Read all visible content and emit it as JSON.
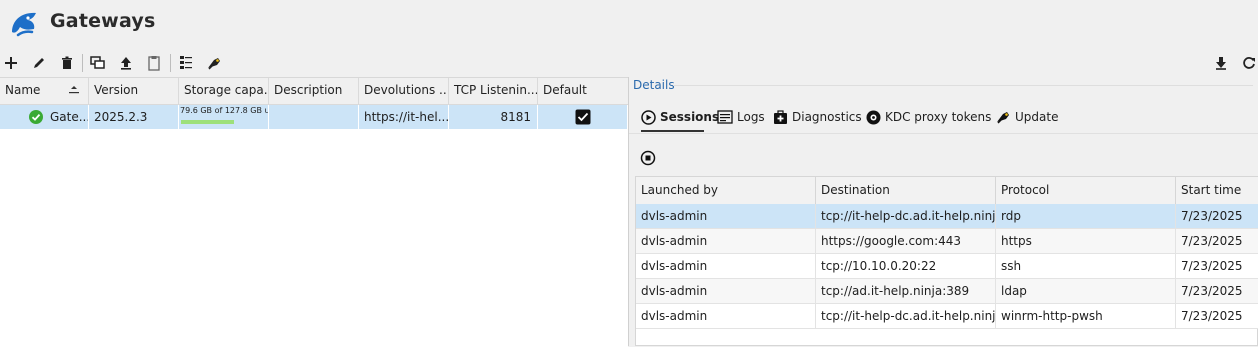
{
  "app": {
    "title": "Gateways"
  },
  "toolbar": {
    "left": [
      "add-icon",
      "edit-icon",
      "delete-icon",
      "duplicate-icon",
      "upload-icon",
      "clipboard-icon",
      "properties-icon",
      "key-icon"
    ],
    "right": [
      "download-icon",
      "refresh-icon"
    ]
  },
  "gateways": {
    "columns": [
      "Name",
      "Version",
      "Storage capa...",
      "Description",
      "Devolutions ...",
      "TCP Listenin...",
      "Default"
    ],
    "rows": [
      {
        "name": "Gate...",
        "version": "2025.2.3",
        "storage": "79.6 GB of 127.8 GB us",
        "storage_fraction": 0.62,
        "description": "",
        "url": "https://it-hel...",
        "tcp_port": "8181",
        "default": true,
        "status": "online"
      }
    ]
  },
  "details": {
    "label": "Details",
    "tabs": [
      {
        "label": "Sessions",
        "icon": "play-icon",
        "active": true
      },
      {
        "label": "Logs",
        "icon": "logs-icon"
      },
      {
        "label": "Diagnostics",
        "icon": "diagnostics-icon"
      },
      {
        "label": "KDC proxy tokens",
        "icon": "token-icon"
      },
      {
        "label": "Update",
        "icon": "update-icon"
      }
    ],
    "sessions": {
      "columns": [
        "Launched by",
        "Destination",
        "Protocol",
        "Start time"
      ],
      "rows": [
        {
          "launched_by": "dvls-admin",
          "destination": "tcp://it-help-dc.ad.it-help.ninj...",
          "protocol": "rdp",
          "start": "7/23/2025"
        },
        {
          "launched_by": "dvls-admin",
          "destination": "https://google.com:443",
          "protocol": "https",
          "start": "7/23/2025"
        },
        {
          "launched_by": "dvls-admin",
          "destination": "tcp://10.10.0.20:22",
          "protocol": "ssh",
          "start": "7/23/2025"
        },
        {
          "launched_by": "dvls-admin",
          "destination": "tcp://ad.it-help.ninja:389",
          "protocol": "ldap",
          "start": "7/23/2025"
        },
        {
          "launched_by": "dvls-admin",
          "destination": "tcp://it-help-dc.ad.it-help.ninj...",
          "protocol": "winrm-http-pwsh",
          "start": "7/23/2025"
        }
      ]
    }
  },
  "colors": {
    "accent": "#1e6fc8",
    "selection": "#cce4f7",
    "online": "#3aaa35",
    "storage_bar": "#9de07a"
  }
}
